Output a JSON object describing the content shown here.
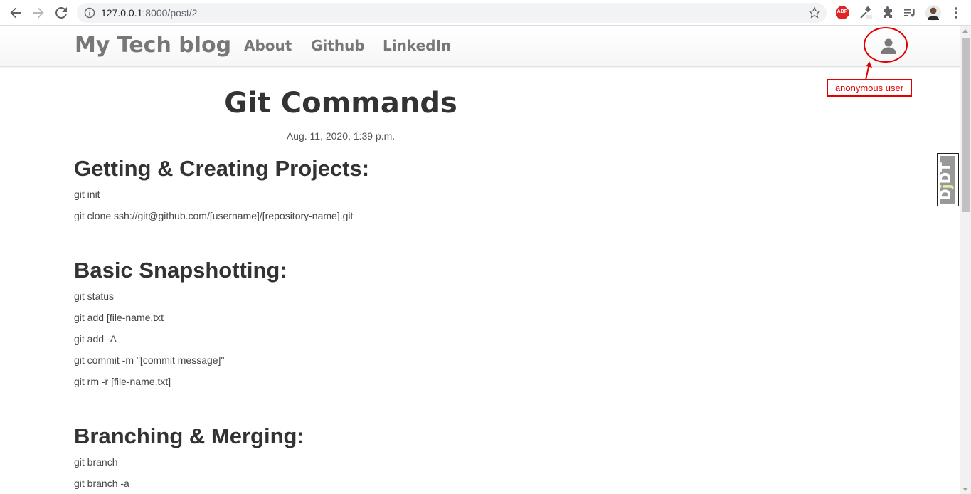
{
  "browser": {
    "url_host": "127.0.0.1",
    "url_rest": ":8000/post/2",
    "abp_label": "ABP"
  },
  "navbar": {
    "brand": "My Tech blog",
    "links": [
      "About",
      "Github",
      "LinkedIn"
    ]
  },
  "annotation": {
    "label": "anonymous user",
    "color": "#e00000"
  },
  "post": {
    "title": "Git Commands",
    "date": "Aug. 11, 2020, 1:39 p.m.",
    "sections": [
      {
        "heading": "Getting & Creating Projects:",
        "commands": [
          "git init",
          "git clone ssh://git@github.com/[username]/[repository-name].git"
        ]
      },
      {
        "heading": "Basic Snapshotting:",
        "commands": [
          "git status",
          "git add [file-name.txt",
          "git add -A",
          "git commit -m \"[commit message]\"",
          "git rm -r [file-name.txt]"
        ]
      },
      {
        "heading": "Branching & Merging:",
        "commands": [
          "git branch",
          "git branch -a"
        ]
      }
    ]
  },
  "djdt": {
    "d": "D",
    "j": "j",
    "dt": "DT"
  }
}
